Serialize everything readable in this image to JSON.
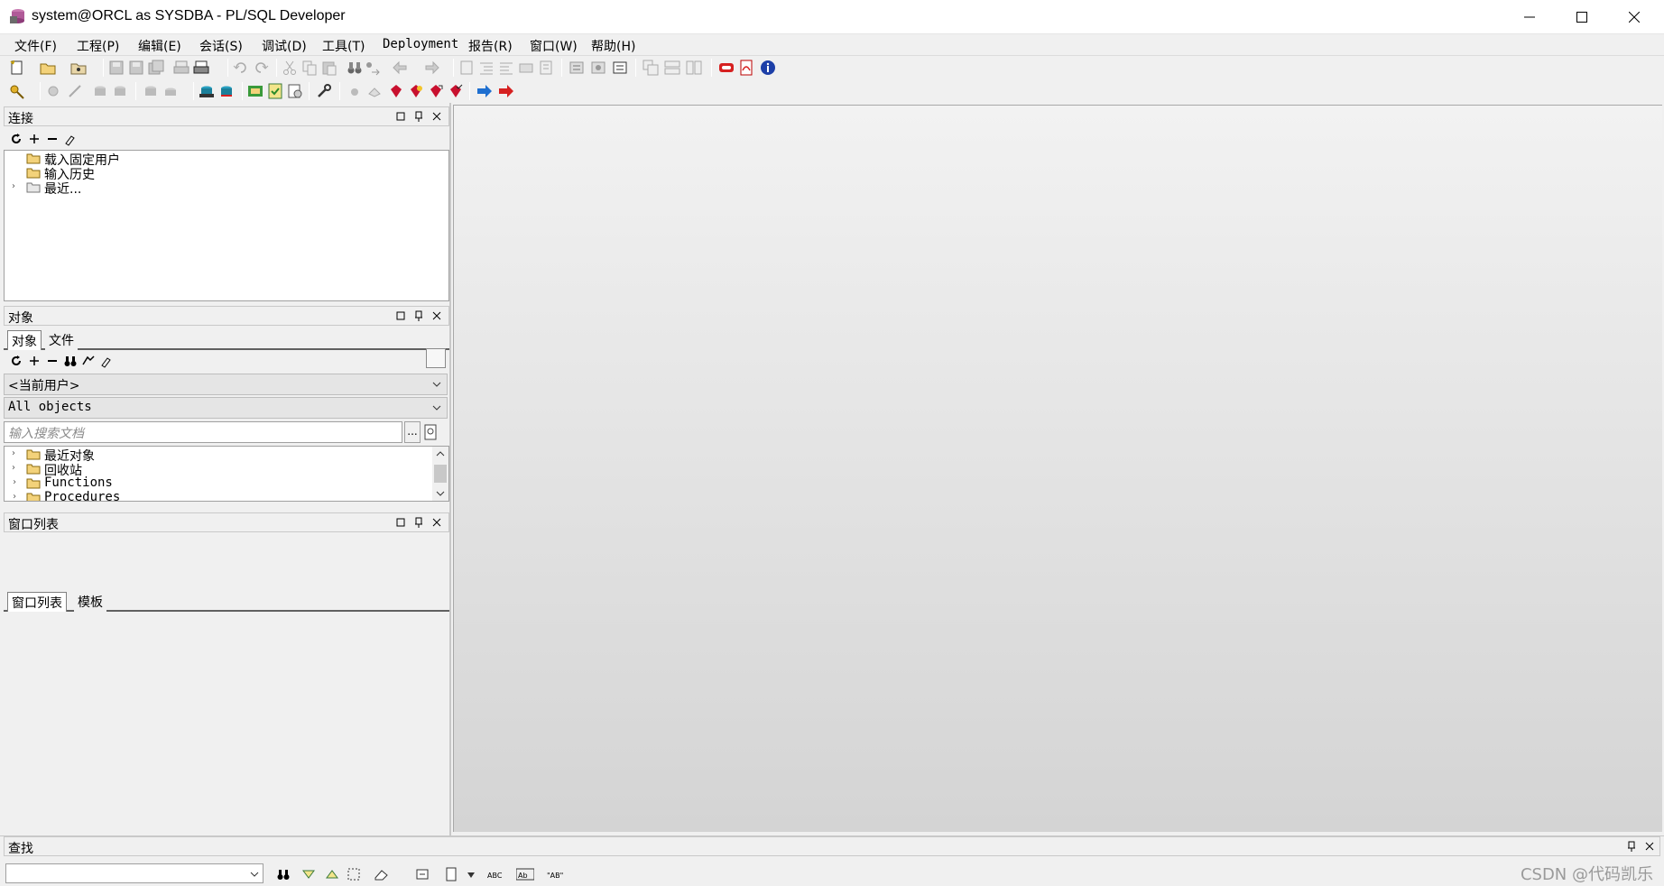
{
  "window": {
    "title": "system@ORCL as SYSDBA - PL/SQL Developer"
  },
  "menu": [
    {
      "label": "文件(F)",
      "name": "menu-file"
    },
    {
      "label": "工程(P)",
      "name": "menu-project"
    },
    {
      "label": "编辑(E)",
      "name": "menu-edit"
    },
    {
      "label": "会话(S)",
      "name": "menu-session"
    },
    {
      "label": "调试(D)",
      "name": "menu-debug"
    },
    {
      "label": "工具(T)",
      "name": "menu-tools"
    },
    {
      "label": "Deployment",
      "name": "menu-deployment"
    },
    {
      "label": "报告(R)",
      "name": "menu-reports"
    },
    {
      "label": "窗口(W)",
      "name": "menu-window"
    },
    {
      "label": "帮助(H)",
      "name": "menu-help"
    }
  ],
  "connections_panel": {
    "title": "连接",
    "items": [
      {
        "label": "载入固定用户",
        "expandable": false
      },
      {
        "label": "输入历史",
        "expandable": false
      },
      {
        "label": "最近...",
        "expandable": true
      }
    ]
  },
  "objects_panel": {
    "title": "对象",
    "tabs": [
      "对象",
      "文件"
    ],
    "active_tab": "对象",
    "user_combo": "<当前用户>",
    "filter_combo": "All objects",
    "search_placeholder": "输入搜索文档",
    "search_button_label": "...",
    "items": [
      {
        "label": "最近对象"
      },
      {
        "label": "回收站"
      },
      {
        "label": "Functions"
      },
      {
        "label": "Procedures"
      }
    ]
  },
  "window_list_panel": {
    "title": "窗口列表",
    "tabs": [
      "窗口列表",
      "模板"
    ],
    "active_tab": "窗口列表"
  },
  "find_bar": {
    "title": "查找",
    "query": ""
  },
  "watermark": "CSDN @代码凯乐",
  "colors": {
    "accent_blue": "#1e6fd0",
    "accent_red": "#d62020",
    "folder_yellow": "#f3d27a"
  }
}
